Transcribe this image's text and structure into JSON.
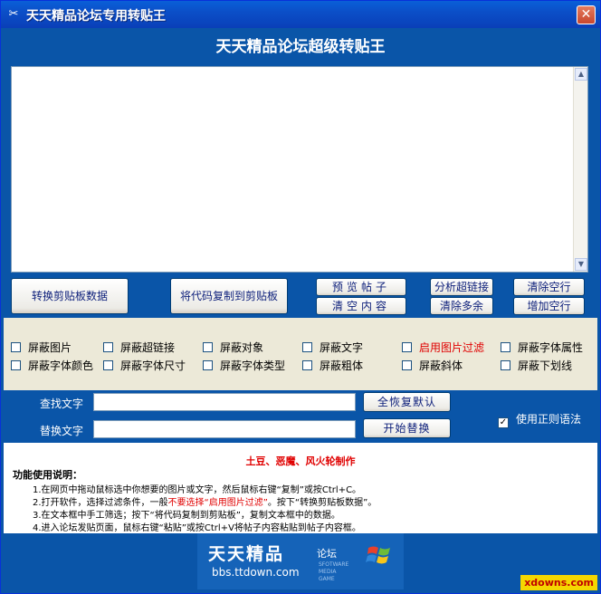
{
  "window": {
    "title": "天天精品论坛专用转贴王",
    "close_glyph": "✕",
    "app_icon": "scissors-icon"
  },
  "main_title": "天天精品论坛超级转贴王",
  "textbox": {
    "value": ""
  },
  "buttons": {
    "convert_clipboard": "转换剪贴板数据",
    "copy_code": "将代码复制到剪贴板",
    "preview": "预览帖子",
    "clear_content": "清空内容",
    "analyze_links": "分析超链接",
    "remove_extra": "清除多余",
    "clear_blank_lines": "清除空行",
    "add_blank_lines": "增加空行",
    "restore_default": "全恢复默认",
    "start_replace": "开始替换"
  },
  "options": [
    {
      "label": "屏蔽图片",
      "checked": false
    },
    {
      "label": "屏蔽超链接",
      "checked": false
    },
    {
      "label": "屏蔽对象",
      "checked": false
    },
    {
      "label": "屏蔽文字",
      "checked": false
    },
    {
      "label": "启用图片过滤",
      "checked": false,
      "highlight": "#E00000"
    },
    {
      "label": "屏蔽字体属性",
      "checked": false
    },
    {
      "label": "屏蔽字体颜色",
      "checked": false
    },
    {
      "label": "屏蔽字体尺寸",
      "checked": false
    },
    {
      "label": "屏蔽字体类型",
      "checked": false
    },
    {
      "label": "屏蔽粗体",
      "checked": false
    },
    {
      "label": "屏蔽斜体",
      "checked": false
    },
    {
      "label": "屏蔽下划线",
      "checked": false
    }
  ],
  "find_replace": {
    "find_label": "查找文字",
    "replace_label": "替换文字",
    "find_value": "",
    "replace_value": "",
    "regex_label": "使用正则语法",
    "regex_checked": true
  },
  "help": {
    "credit": "土豆、恶魔、风火轮制作",
    "heading": "功能使用说明：",
    "step1": "1.在网页中拖动鼠标选中你想要的图片或文字，然后鼠标右键“复制”或按Ctrl+C。",
    "step2_a": "2.打开软件，选择过滤条件，一般",
    "step2_warn": "不要选择“启用图片过滤”",
    "step2_b": "。按下“转换剪贴板数据”。",
    "step3": "3.在文本框中手工筛选；按下“将代码复制到剪贴板”，复制文本框中的数据。",
    "step4": "4.进入论坛发贴页面，鼠标右键“粘贴”或按Ctrl+V将帖子内容粘贴到帖子内容框。"
  },
  "logo": {
    "name": "天天精品",
    "forum": "论坛",
    "url": "bbs.ttdown.com",
    "tags": [
      "SFOTWARE",
      "MEDIA",
      "GAME"
    ]
  },
  "watermark": "xdowns.com",
  "colors": {
    "panel_blue": "#0A55A8",
    "title_blue": "#0B4FC8",
    "warning_red": "#E00000",
    "button_text": "#0C1E7A"
  }
}
